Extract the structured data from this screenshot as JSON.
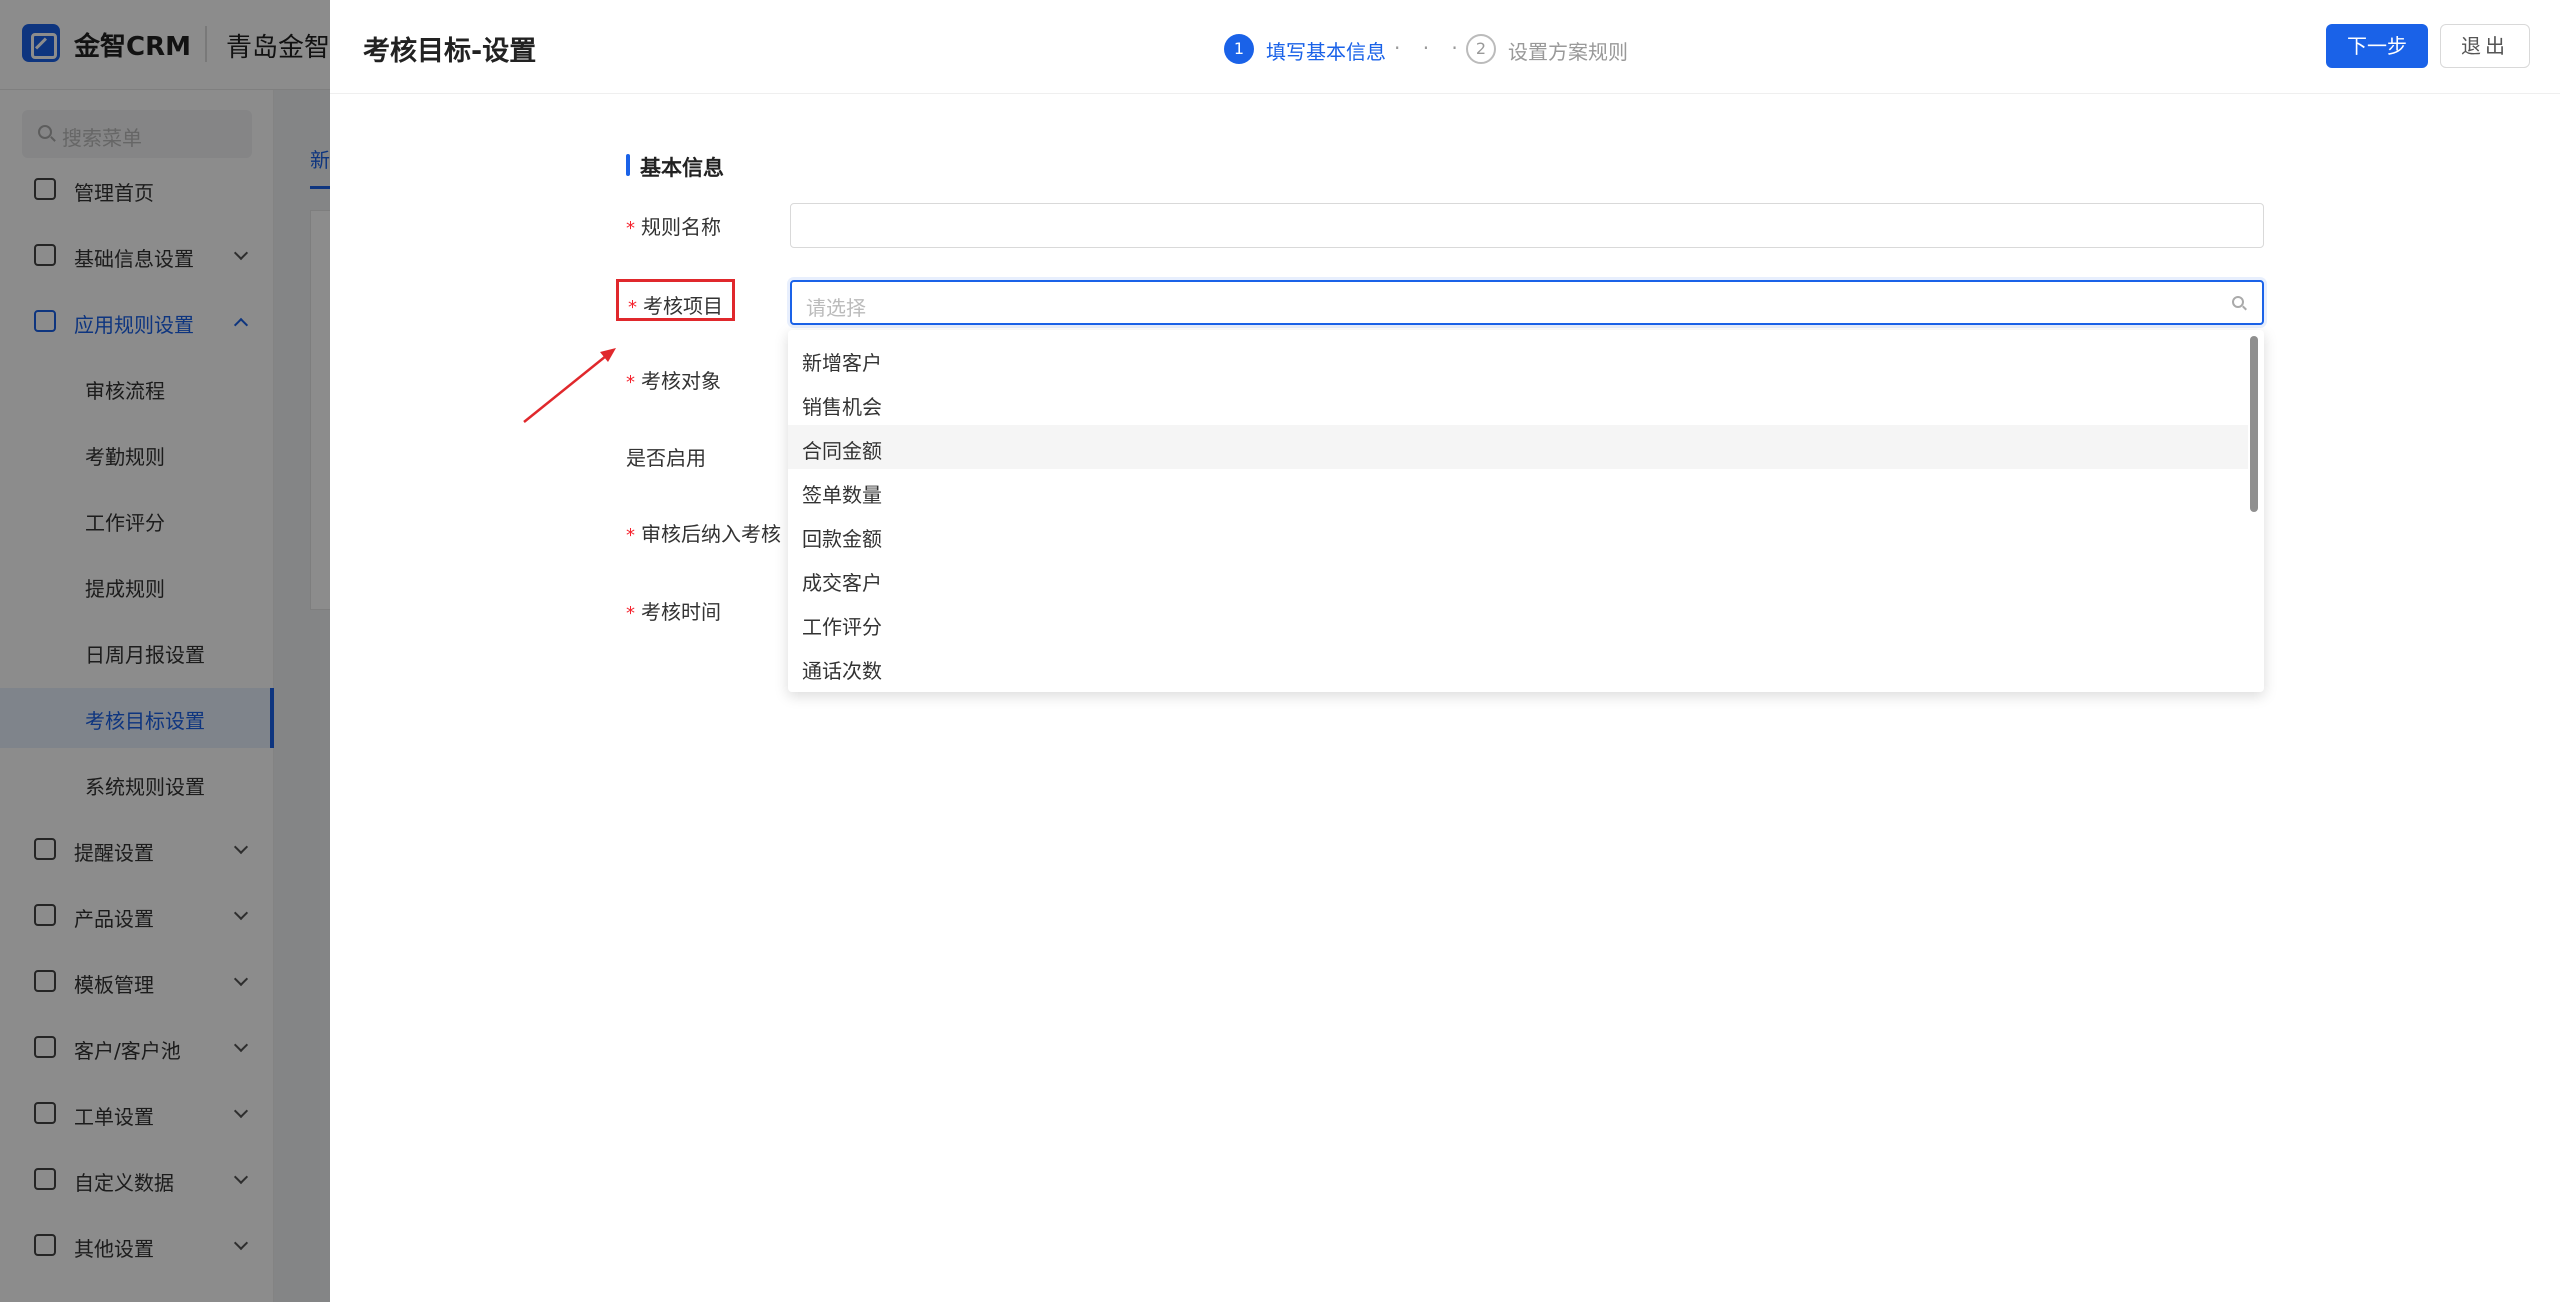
{
  "app": {
    "brand": "金智CRM",
    "company": "青岛金智"
  },
  "sidebar": {
    "search_placeholder": "搜索菜单",
    "items": [
      {
        "label": "管理首页"
      },
      {
        "label": "基础信息设置"
      },
      {
        "label": "应用规则设置"
      },
      {
        "label": "提醒设置"
      },
      {
        "label": "产品设置"
      },
      {
        "label": "模板管理"
      },
      {
        "label": "客户/客户池"
      },
      {
        "label": "工单设置"
      },
      {
        "label": "自定义数据"
      },
      {
        "label": "其他设置"
      }
    ],
    "sub_items": [
      {
        "label": "审核流程"
      },
      {
        "label": "考勤规则"
      },
      {
        "label": "工作评分"
      },
      {
        "label": "提成规则"
      },
      {
        "label": "日周月报设置"
      },
      {
        "label": "考核目标设置"
      },
      {
        "label": "系统规则设置"
      }
    ]
  },
  "background": {
    "tab_label": "新"
  },
  "drawer": {
    "title": "考核目标-设置",
    "steps": [
      {
        "num": "1",
        "label": "填写基本信息"
      },
      {
        "num": "2",
        "label": "设置方案规则"
      }
    ],
    "step_dots": "· · ·",
    "next_button": "下一步",
    "exit_button": "退出"
  },
  "form": {
    "section_title": "基本信息",
    "required_mark": "*",
    "labels": {
      "rule_name": "规则名称",
      "assessment_item": "考核项目",
      "assessment_target": "考核对象",
      "enabled": "是否启用",
      "after_review": "审核后纳入考核",
      "assessment_time": "考核时间"
    },
    "assessment_item_placeholder": "请选择",
    "dropdown_options": [
      {
        "label": "新增客户"
      },
      {
        "label": "销售机会"
      },
      {
        "label": "合同金额"
      },
      {
        "label": "签单数量"
      },
      {
        "label": "回款金额"
      },
      {
        "label": "成交客户"
      },
      {
        "label": "工作评分"
      },
      {
        "label": "通话次数"
      }
    ]
  },
  "colors": {
    "primary": "#1a62e8",
    "required": "#f5222d",
    "annotation": "#e0282c"
  },
  "icons": {
    "search_menu": "search-icon",
    "select_search": "search-icon"
  }
}
